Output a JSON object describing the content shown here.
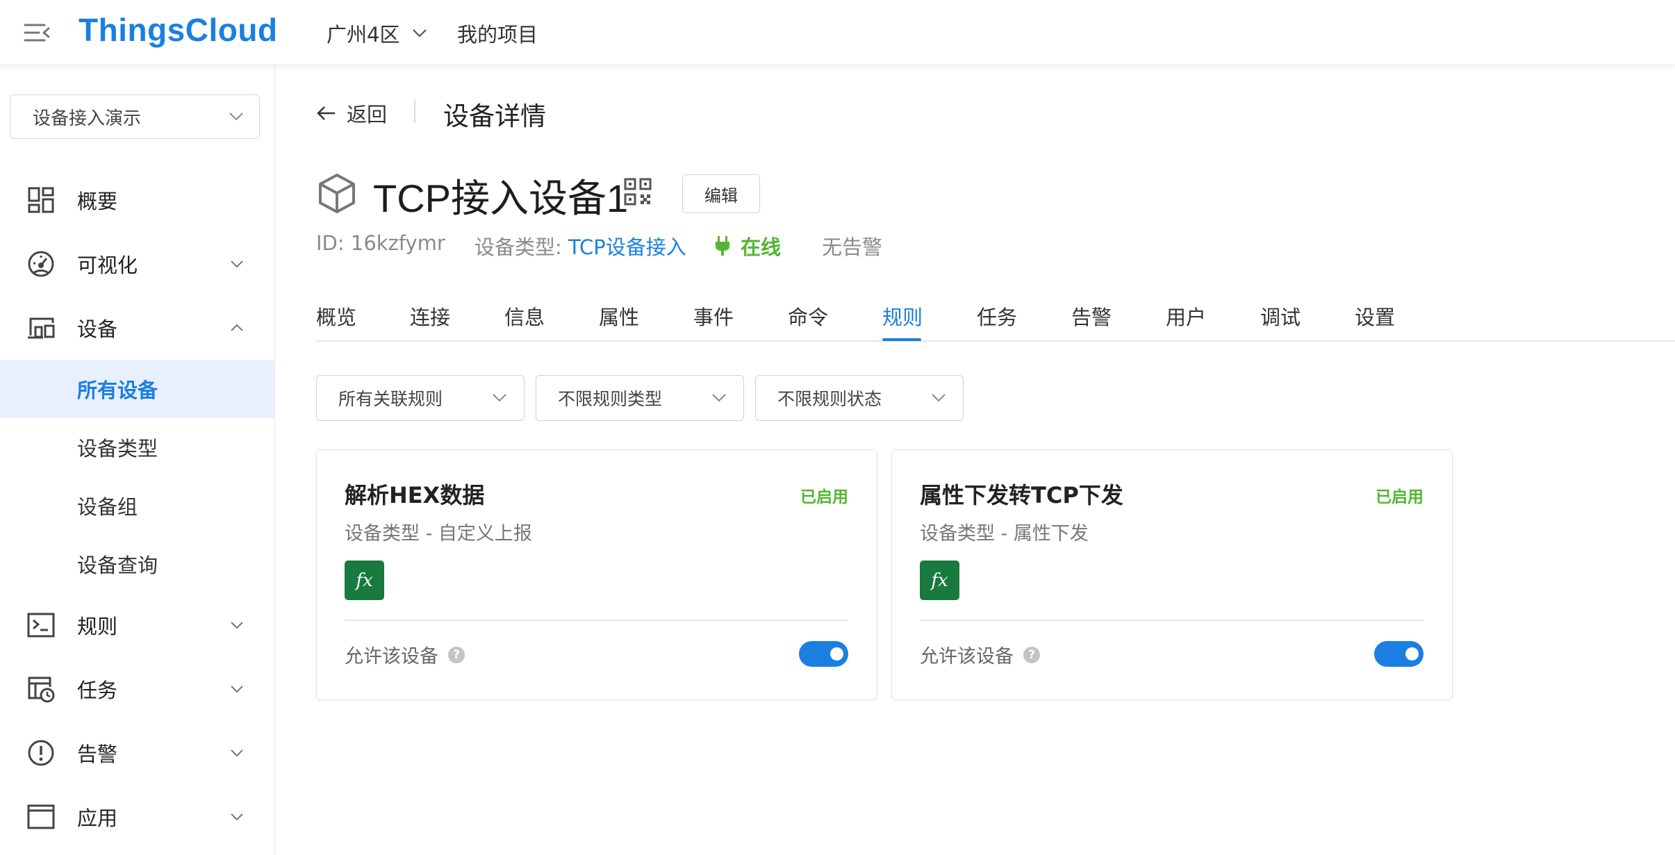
{
  "header": {
    "brand": "ThingsCloud",
    "region": "广州4区",
    "my_projects": "我的项目"
  },
  "sidebar": {
    "project_select": "设备接入演示",
    "items": [
      {
        "label": "概要",
        "icon": "dashboard-grid-icon"
      },
      {
        "label": "可视化",
        "icon": "gauge-icon"
      },
      {
        "label": "设备",
        "icon": "devices-icon"
      },
      {
        "label": "规则",
        "icon": "terminal-icon"
      },
      {
        "label": "任务",
        "icon": "task-clock-icon"
      },
      {
        "label": "告警",
        "icon": "alert-circle-icon"
      },
      {
        "label": "应用",
        "icon": "app-window-icon"
      }
    ],
    "device_sub": [
      "所有设备",
      "设备类型",
      "设备组",
      "设备查询"
    ],
    "active_sub": "所有设备"
  },
  "page": {
    "back": "返回",
    "title": "设备详情"
  },
  "device": {
    "name": "TCP接入设备1",
    "edit": "编辑",
    "id_label": "ID: 16kzfymr",
    "type_label": "设备类型: ",
    "type_value": "TCP设备接入",
    "status": "在线",
    "alarm": "无告警"
  },
  "tabs": [
    "概览",
    "连接",
    "信息",
    "属性",
    "事件",
    "命令",
    "规则",
    "任务",
    "告警",
    "用户",
    "调试",
    "设置"
  ],
  "active_tab": "规则",
  "filters": [
    "所有关联规则",
    "不限规则类型",
    "不限规则状态"
  ],
  "rules": [
    {
      "title": "解析HEX数据",
      "status": "已启用",
      "subtitle": "设备类型 - 自定义上报",
      "fx": "fx",
      "allow_label": "允许该设备",
      "enabled": true
    },
    {
      "title": "属性下发转TCP下发",
      "status": "已启用",
      "subtitle": "设备类型 - 属性下发",
      "fx": "fx",
      "allow_label": "允许该设备",
      "enabled": true
    }
  ],
  "colors": {
    "accent": "#1a7fe0",
    "online": "#52b533",
    "fx_badge": "#197a3e",
    "active_bg": "#e8f0fd"
  }
}
